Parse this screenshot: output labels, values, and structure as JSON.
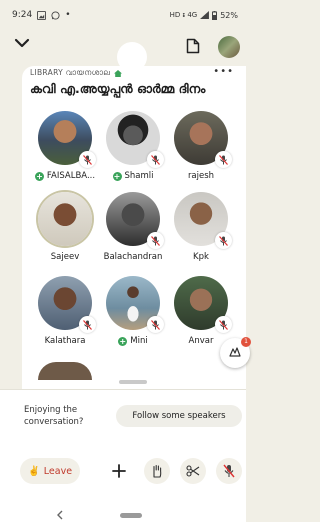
{
  "status_bar": {
    "time": "9:24",
    "dot": "•",
    "network": "HD ᵻ 4G",
    "battery": "52%"
  },
  "room": {
    "club_name": "LIBRARY വായനശാല",
    "more_label": "•••",
    "title": "കവി എ.അയ്യപ്പൻ ഓർമ്മ ദിനം"
  },
  "speakers": [
    {
      "name": "FAISALBA...",
      "plus": true,
      "icon": "mic-off-icon"
    },
    {
      "name": "Shamli",
      "plus": true,
      "icon": "mic-off-icon"
    },
    {
      "name": "rajesh",
      "plus": false,
      "icon": "mic-off-icon"
    },
    {
      "name": "Sajeev",
      "plus": false,
      "icon": ""
    },
    {
      "name": "Balachandran",
      "plus": false,
      "icon": "mic-off-icon"
    },
    {
      "name": "Kpk",
      "plus": false,
      "icon": "mic-off-icon"
    },
    {
      "name": "Kalathara",
      "plus": false,
      "icon": "mic-off-icon"
    },
    {
      "name": "Mini",
      "plus": true,
      "icon": "mic-off-icon"
    },
    {
      "name": "Anvar",
      "plus": false,
      "icon": "mic-off-icon"
    }
  ],
  "panel": {
    "prompt": "Enjoying the conversation?",
    "follow_label": "Follow some speakers",
    "leave_label": "Leave",
    "leave_emoji": "✌️"
  },
  "fab": {
    "badge": "1"
  },
  "colors": {
    "background": "#f1efe6",
    "accent_green": "#3aa35a",
    "leave_red": "#c0392b",
    "notification": "#e1523d"
  }
}
